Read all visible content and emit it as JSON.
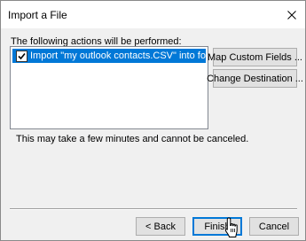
{
  "window": {
    "title": "Import a File"
  },
  "actions": {
    "label": "The following actions will be performed:",
    "items": [
      {
        "checked": true,
        "text": "Import \"my outlook contacts.CSV\" into folder: Contacts"
      }
    ]
  },
  "side_buttons": {
    "map_custom_fields": "Map Custom Fields ...",
    "change_destination": "Change Destination ..."
  },
  "note": "This may take a few minutes and cannot be canceled.",
  "footer": {
    "back": "< Back",
    "finish": "Finish",
    "cancel": "Cancel"
  },
  "icons": {
    "close": "close-icon",
    "checkbox": "checkmark-icon",
    "cursor": "hand-pointer-icon"
  },
  "colors": {
    "selection": "#0078d7",
    "finish_border": "#0078d7"
  }
}
